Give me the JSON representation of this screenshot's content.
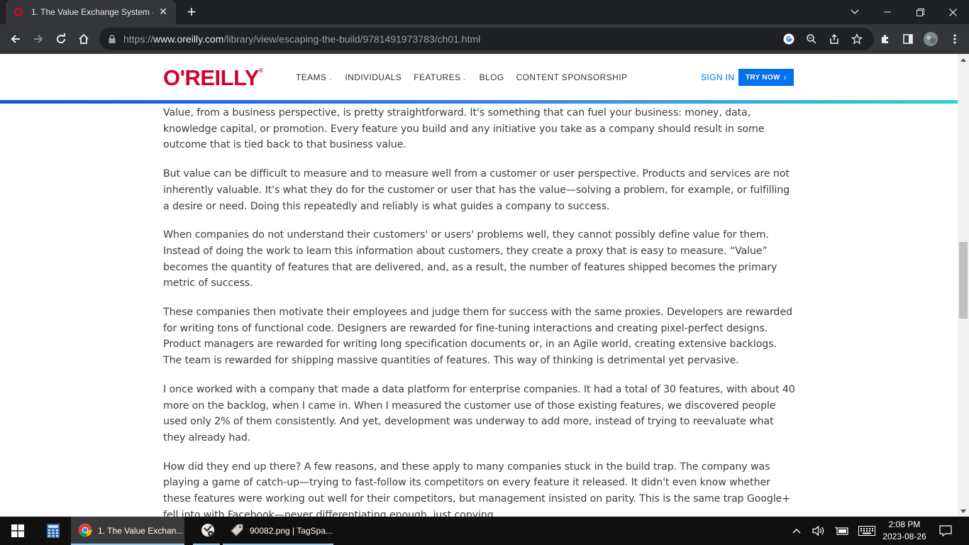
{
  "browser": {
    "tab_title": "1. The Value Exchange System - E",
    "url_prefix": "https://",
    "url_host": "www.oreilly.com",
    "url_path": "/library/view/escaping-the-build/9781491973783/ch01.html"
  },
  "site": {
    "logo": "O'REILLY",
    "nav": [
      "TEAMS",
      "INDIVIDUALS",
      "FEATURES",
      "BLOG",
      "CONTENT SPONSORSHIP"
    ],
    "sign_in": "SIGN IN",
    "try_now": "TRY NOW"
  },
  "article": {
    "paragraphs": [
      "Value, from a business perspective, is pretty straightforward. It's something that can fuel your business: money, data, knowledge capital, or promotion. Every feature you build and any initiative you take as a company should result in some outcome that is tied back to that business value.",
      "But value can be difficult to measure and to measure well from a customer or user perspective. Products and services are not in­herently valuable. It's what they do for the customer or user that has the value—solving a problem, for example, or fulfilling a de­sire or need. Doing this repeatedly and reliably is what guides a company to success.",
      "When companies do not understand their customers' or users' problems well, they cannot possibly define value for them. Instead of doing the work to learn this information about customers, they create a proxy that is easy to measure. “Value” becomes the quantity of features that are delivered, and, as a result, the number of features shipped becomes the primary metric of success.",
      "These companies then motivate their employees and judge them for success with the same proxies. Developers are rewarded for writing tons of functional code. Designers are rewarded for fine-tuning interactions and creating pixel-perfect designs. Product managers are rewarded for writing long specification documents or, in an Agile world, creating extensive backlogs. The team is re­warded for shipping massive quantities of features. This way of thinking is detrimental yet pervasive.",
      "I once worked with a company that made a data platform for enterprise companies. It had a total of 30 features, with about 40 more on the backlog, when I came in. When I measured the customer use of those existing features, we discovered people used only 2% of them consistently. And yet, development was underway to add more, instead of trying to reevaluate what they al­ready had.",
      "How did they end up there? A few reasons, and these apply to many companies stuck in the build trap. The company was playing a game of catch-up—trying to fast-follow its competitors on every feature it released. It didn't even know whether these features were working out well for their competitors, but management insisted on parity. This is the same trap Google+ fell into with Facebook—never differentiating enough, just copying."
    ]
  },
  "taskbar": {
    "apps": [
      {
        "label": "1. The Value Exchan..."
      },
      {
        "label": "90082.png | TagSpa..."
      }
    ],
    "time": "2:08 PM",
    "date": "2023-08-26"
  },
  "colors": {
    "brand_red": "#d3002d",
    "brand_blue": "#0071eb",
    "gradient_start": "#0d59d6",
    "gradient_end": "#2fd0d8"
  }
}
